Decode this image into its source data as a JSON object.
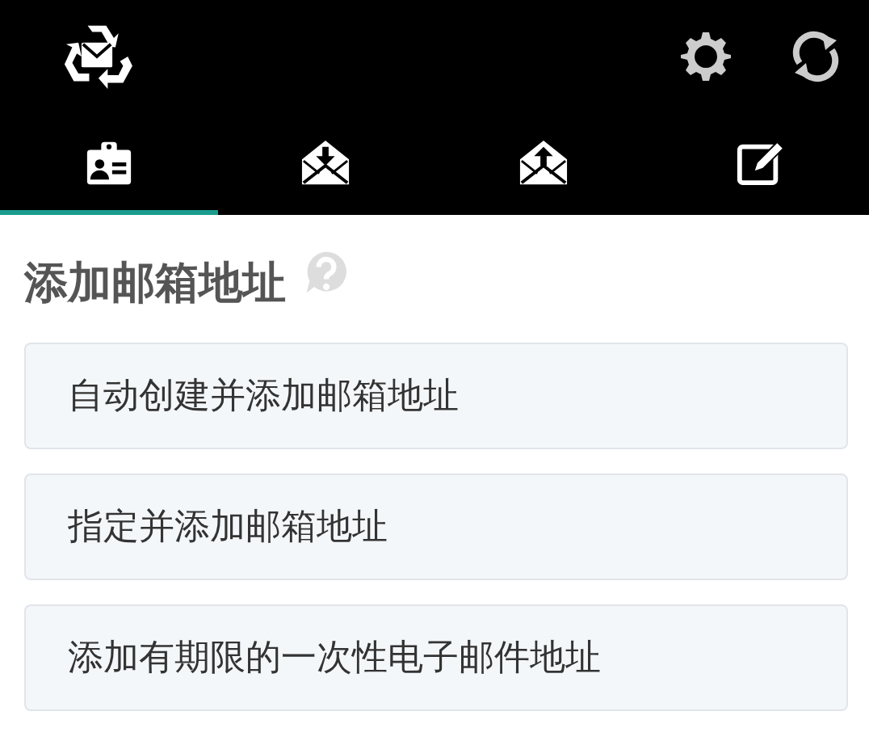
{
  "tabs": [
    {
      "kind": "id-card",
      "selected": true
    },
    {
      "kind": "inbox",
      "selected": false
    },
    {
      "kind": "outbox",
      "selected": false
    },
    {
      "kind": "compose",
      "selected": false
    }
  ],
  "title": "添加邮箱地址",
  "options": [
    {
      "label": "自动创建并添加邮箱地址"
    },
    {
      "label": "指定并添加邮箱地址"
    },
    {
      "label": "添加有期限的一次性电子邮件地址"
    }
  ]
}
